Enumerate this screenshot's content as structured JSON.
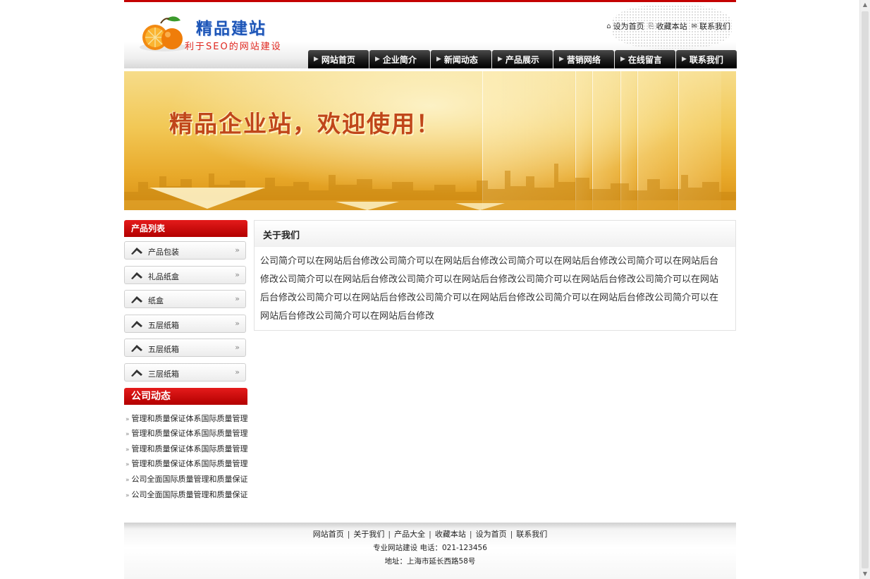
{
  "header": {
    "logo_title": "精品建站",
    "logo_subtitle": "利于SEO的网站建设",
    "top_links": [
      {
        "label": "设为首页",
        "icon": "home-icon"
      },
      {
        "label": "收藏本站",
        "icon": "favorites-icon"
      },
      {
        "label": "联系我们",
        "icon": "contact-icon"
      }
    ]
  },
  "nav": [
    "网站首页",
    "企业简介",
    "新闻动态",
    "产品展示",
    "营销网络",
    "在线留言",
    "联系我们"
  ],
  "banner": {
    "slogan": "精品企业站，欢迎使用！"
  },
  "sidebar": {
    "product_title": "产品列表",
    "products": [
      "产品包装",
      "礼品纸盒",
      "纸盒",
      "五层纸箱",
      "五层纸箱",
      "三层纸箱"
    ],
    "news_title": "公司动态",
    "news": [
      "管理和质量保证体系国际质量管理",
      "管理和质量保证体系国际质量管理",
      "管理和质量保证体系国际质量管理",
      "管理和质量保证体系国际质量管理",
      "公司全面国际质量管理和质量保证",
      "公司全面国际质量管理和质量保证"
    ]
  },
  "main": {
    "title": "关于我们",
    "content": "公司简介可以在网站后台修改公司简介可以在网站后台修改公司简介可以在网站后台修改公司简介可以在网站后台修改公司简介可以在网站后台修改公司简介可以在网站后台修改公司简介可以在网站后台修改公司简介可以在网站后台修改公司简介可以在网站后台修改公司简介可以在网站后台修改公司简介可以在网站后台修改公司简介可以在网站后台修改公司简介可以在网站后台修改"
  },
  "footer": {
    "links": [
      "网站首页",
      "关于我们",
      "产品大全",
      "收藏本站",
      "设为首页",
      "联系我们"
    ],
    "line1": "专业网站建设 电话：021-123456",
    "line2": "地址：上海市延长西路58号"
  },
  "colors": {
    "accent_red": "#c40000",
    "logo_blue": "#1d55b6",
    "nav_black": "#1c1c1c",
    "banner_gold": "#f2c856"
  }
}
